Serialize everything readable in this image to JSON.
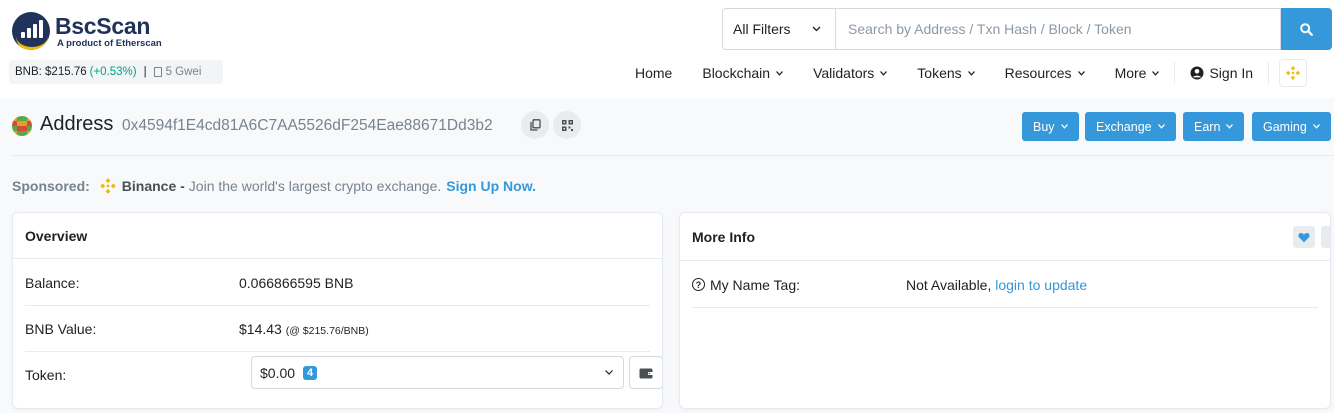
{
  "brand": {
    "title": "BscScan",
    "subtitle": "A product of Etherscan"
  },
  "price": {
    "label": "BNB: $215.76",
    "change": "(+0.53%)",
    "separator": "|",
    "gas": "5 Gwei"
  },
  "search": {
    "filter_label": "All Filters",
    "placeholder": "Search by Address / Txn Hash / Block / Token"
  },
  "nav": {
    "home": "Home",
    "blockchain": "Blockchain",
    "validators": "Validators",
    "tokens": "Tokens",
    "resources": "Resources",
    "more": "More",
    "signin": "Sign In"
  },
  "address": {
    "title": "Address",
    "hash": "0x4594f1E4cd81A6C7AA5526dF254Eae88671Dd3b2"
  },
  "actions": {
    "buy": "Buy",
    "exchange": "Exchange",
    "earn": "Earn",
    "gaming": "Gaming"
  },
  "sponsor": {
    "label": "Sponsored:",
    "brand": "Binance -",
    "text": "Join the world's largest crypto exchange.",
    "link": "Sign Up Now."
  },
  "overview": {
    "title": "Overview",
    "balance_label": "Balance:",
    "balance_value": "0.066866595 BNB",
    "value_label": "BNB Value:",
    "value_amount": "$14.43",
    "value_rate": "(@ $215.76/BNB)",
    "token_label": "Token:",
    "token_value": "$0.00",
    "token_count": "4"
  },
  "moreinfo": {
    "title": "More Info",
    "tag_label": "My Name Tag:",
    "tag_value": "Not Available,",
    "tag_link": "login to update"
  },
  "colors": {
    "accent": "#3498db",
    "brand_navy": "#21325b",
    "bnb_yellow": "#f0b90b",
    "positive": "#00a186"
  },
  "icons": [
    "chevron-down-icon",
    "search-icon",
    "user-icon",
    "bnb-icon",
    "copy-icon",
    "qr-code-icon",
    "wallet-icon",
    "heart-icon",
    "more-vertical-icon",
    "question-icon",
    "gas-pump-icon"
  ]
}
